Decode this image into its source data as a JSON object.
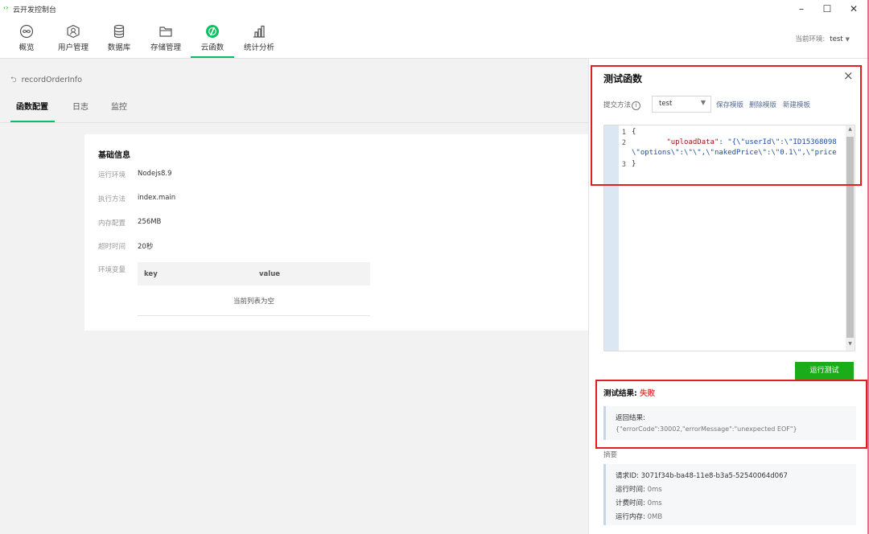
{
  "window": {
    "title": "云开发控制台",
    "minimize": "–",
    "maximize": "☐",
    "close": "✕"
  },
  "nav": {
    "items": [
      {
        "label": "概览",
        "icon": "overview-icon"
      },
      {
        "label": "用户管理",
        "icon": "users-icon"
      },
      {
        "label": "数据库",
        "icon": "database-icon"
      },
      {
        "label": "存储管理",
        "icon": "folder-icon"
      },
      {
        "label": "云函数",
        "icon": "function-icon"
      },
      {
        "label": "统计分析",
        "icon": "chart-icon"
      }
    ],
    "active_index": 4,
    "env_label": "当前环境:",
    "env_value": "test"
  },
  "function": {
    "name": "recordOrderInfo",
    "tabs": [
      "函数配置",
      "日志",
      "监控"
    ]
  },
  "basic_info": {
    "title": "基础信息",
    "rows": [
      {
        "label": "运行环境",
        "value": "Nodejs8.9"
      },
      {
        "label": "执行方法",
        "value": "index.main"
      },
      {
        "label": "内存配置",
        "value": "256MB"
      },
      {
        "label": "超时时间",
        "value": "20秒"
      }
    ],
    "env_var_label": "环境变量",
    "table": {
      "key_header": "key",
      "value_header": "value",
      "empty_text": "当前列表为空"
    }
  },
  "test_panel": {
    "title": "测试函数",
    "close": "×",
    "submit_label": "提交方法",
    "template_value": "test",
    "links": [
      "保存模版",
      "删除模版",
      "新建模板"
    ],
    "code": {
      "line_numbers": [
        "1",
        "2",
        "3"
      ],
      "line1": "{",
      "line2_key": "\"uploadData\"",
      "line2_rest": ": \"{\\\"userId\\\":\\\"ID15368098",
      "line2_wrap": "\\\"options\\\":\\\"\\\",\\\"nakedPrice\\\":\\\"0.1\\\",\\\"price",
      "line3": "}"
    },
    "run_button": "运行测试",
    "result": {
      "label": "测试结果:",
      "status": "失败",
      "return_label": "返回结果:",
      "return_value": "{\"errorCode\":30002,\"errorMessage\":\"unexpected EOF\"}"
    },
    "summary": {
      "label": "摘要",
      "lines": [
        {
          "key": "请求ID:",
          "value": "3071f34b-ba48-11e8-b3a5-52540064d067"
        },
        {
          "key": "运行时间:",
          "value": "0ms"
        },
        {
          "key": "计费时间:",
          "value": "0ms"
        },
        {
          "key": "运行内存:",
          "value": "0MB"
        }
      ]
    }
  },
  "colors": {
    "accent": "#1aad19",
    "link": "#576b95",
    "error": "#e64340",
    "annotation": "#e02020"
  }
}
